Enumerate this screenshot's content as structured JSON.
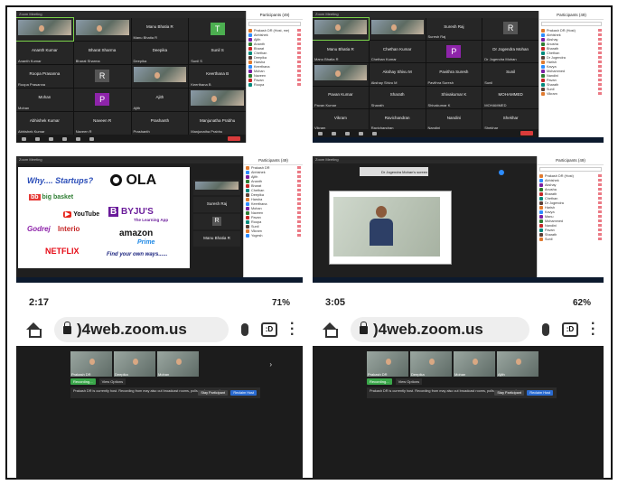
{
  "panel1": {
    "title": "Zoom Meeting",
    "tiles": [
      {
        "name": "",
        "type": "cam"
      },
      {
        "name": "",
        "type": "cam"
      },
      {
        "name": "Manu Bhatia R",
        "type": "text"
      },
      {
        "name": "T",
        "type": "avatar",
        "color": "#4caf50"
      },
      {
        "name": "Ananth Kumar",
        "type": "text"
      },
      {
        "name": "Bharat Sharma",
        "type": "text"
      },
      {
        "name": "Deepika",
        "type": "text"
      },
      {
        "name": "Sunil S",
        "type": "text"
      },
      {
        "name": "Roopa Prasanna",
        "type": "text"
      },
      {
        "name": "R",
        "type": "avatar",
        "color": "#555555"
      },
      {
        "name": "",
        "type": "cam"
      },
      {
        "name": "Keerthana B",
        "type": "text"
      },
      {
        "name": "Mohan",
        "type": "text"
      },
      {
        "name": "P",
        "type": "avatar",
        "color": "#8e24aa"
      },
      {
        "name": "Ajith",
        "type": "text"
      },
      {
        "name": "",
        "type": "cam"
      },
      {
        "name": "Abhishek Kumar",
        "type": "text"
      },
      {
        "name": "Naveen R",
        "type": "text"
      },
      {
        "name": "Prashanth",
        "type": "text"
      },
      {
        "name": "Manjunatha Prabhu",
        "type": "text"
      }
    ],
    "sidebar_title": "Participants (49)",
    "participants": [
      "Prakash DR (Host, me)",
      "Abhishek",
      "Ajith",
      "Ananth",
      "Bharat",
      "Chethan",
      "Deepika",
      "Harsha",
      "Keerthana",
      "Mohan",
      "Naveen",
      "Pavan",
      "Roopa"
    ]
  },
  "panel2": {
    "title": "Zoom Meeting",
    "tiles": [
      {
        "name": "",
        "type": "cam"
      },
      {
        "name": "",
        "type": "cam"
      },
      {
        "name": "Suresh Raj",
        "type": "text"
      },
      {
        "name": "R",
        "type": "avatar",
        "color": "#555555"
      },
      {
        "name": "Manu Bhatia R",
        "type": "text"
      },
      {
        "name": "Chethan Kumar",
        "type": "text"
      },
      {
        "name": "P",
        "type": "avatar",
        "color": "#8e24aa"
      },
      {
        "name": "Dr Jogendra Mohan",
        "type": "text"
      },
      {
        "name": "",
        "type": "cam"
      },
      {
        "name": "Akshay Shivu M",
        "type": "text"
      },
      {
        "name": "Pavithra Suresh",
        "type": "text"
      },
      {
        "name": "Sunil",
        "type": "text"
      },
      {
        "name": "Pavan Kumar",
        "type": "text"
      },
      {
        "name": "Sharath",
        "type": "text"
      },
      {
        "name": "Shivakumar K",
        "type": "text"
      },
      {
        "name": "MOHAMMED",
        "type": "text"
      },
      {
        "name": "Vikram",
        "type": "text"
      },
      {
        "name": "Ravichandran",
        "type": "text"
      },
      {
        "name": "Nandini",
        "type": "text"
      },
      {
        "name": "Shekhar",
        "type": "text"
      }
    ],
    "sidebar_title": "Participants (49)",
    "participants": [
      "Prakash DR (Host)",
      "Abhishek",
      "Akshay",
      "Anusha",
      "Bharath",
      "Chethan",
      "Dr Jogendra",
      "Harish",
      "Kavya",
      "Mohammed",
      "Nandini",
      "Pavan",
      "Sharath",
      "Sunil",
      "Vikram"
    ]
  },
  "panel3": {
    "title": "Zoom Meeting",
    "slide": {
      "heading": "Why.... Startups?",
      "bigbasket": "big basket",
      "ola": "OLA",
      "youtube": "YouTube",
      "byjus": "BYJU'S",
      "byjus_tag": "The Learning App",
      "godrej": "Godrej",
      "interio": "Interio",
      "amazon": "amazon",
      "prime": "Prime",
      "netflix": "NETFLIX",
      "tagline": "Find your own ways......"
    },
    "side_tiles": [
      "",
      "Suresh Raj",
      "R",
      "Manu Bhatia R"
    ],
    "sidebar_title": "Participants (49)",
    "participants": [
      "Prakash DR",
      "Abhishek",
      "Ajith",
      "Ananth",
      "Bharat",
      "Chethan",
      "Deepika",
      "Harsha",
      "Keerthana",
      "Mohan",
      "Naveen",
      "Pavan",
      "Roopa",
      "Sunil",
      "Vikram",
      "Yogesh"
    ]
  },
  "panel4": {
    "title": "Zoom Meeting",
    "share_label": "Dr Jogendra Mohan's screen",
    "sidebar_title": "Participants (49)",
    "participants": [
      "Prakash DR (Host)",
      "Abhishek",
      "Akshay",
      "Anusha",
      "Bharath",
      "Chethan",
      "Dr Jogendra",
      "Harish",
      "Kavya",
      "Manu",
      "Mohammed",
      "Nandini",
      "Pavan",
      "Sharath",
      "Sunil"
    ]
  },
  "phone1": {
    "time": "2:17",
    "battery": "71%",
    "url": ")4web.zoom.us",
    "tabs": ":D",
    "tiles": [
      "Prakash DR",
      "Deepika",
      "Mohan"
    ],
    "recording": "Recording...",
    "view_options": "View Options",
    "notice": "Prakash DR is currently host. Recording from may also cut broadcast rooms, polls, and screen share.",
    "stay_btn": "Stay Participant",
    "reclaim_btn": "Reclaim Host"
  },
  "phone2": {
    "time": "3:05",
    "battery": "62%",
    "url": ")4web.zoom.us",
    "tabs": ":D",
    "tiles": [
      "Prakash DR",
      "Deepika",
      "Mohan",
      "Ajith"
    ],
    "recording": "Recording...",
    "view_options": "View Options",
    "notice": "Prakash DR is currently host. Recording from may also cut broadcast rooms, polls, and screen share.",
    "stay_btn": "Stay Participant",
    "reclaim_btn": "Reclaim Host"
  }
}
